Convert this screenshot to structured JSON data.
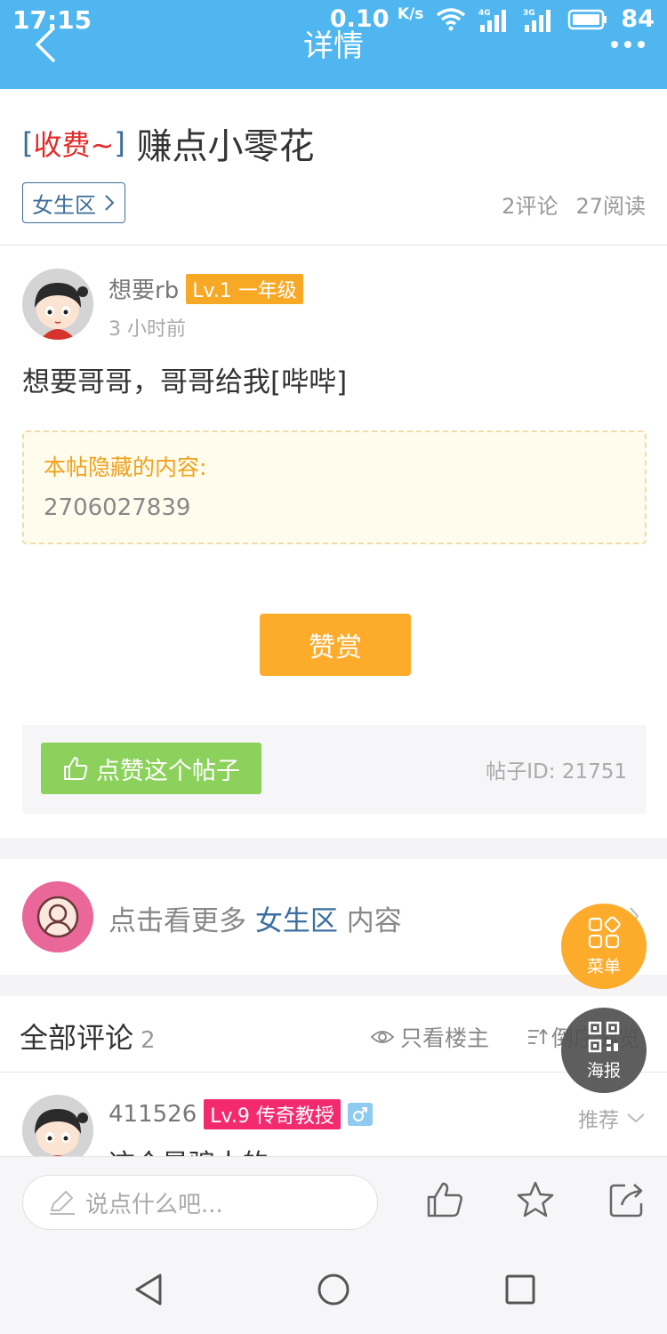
{
  "status_bar": {
    "time": "17:15",
    "network_speed": "0.10",
    "network_unit": "K/s",
    "network_4g": "4G",
    "network_3g": "3G",
    "battery": "84"
  },
  "header": {
    "title": "详情"
  },
  "post": {
    "tag_open": "[",
    "tag": "收费~",
    "tag_close": "]",
    "title": "赚点小零花",
    "section": "女生区",
    "comments_count": "2评论",
    "views_count": "27阅读",
    "author": {
      "name": "想要rb",
      "level": "Lv.1 一年级",
      "time": "3 小时前"
    },
    "content": "想要哥哥，哥哥给我[哔哔]",
    "hidden_label": "本帖隐藏的内容:",
    "hidden_value": "2706027839",
    "reward_label": "赞赏",
    "like_label": "点赞这个帖子",
    "post_id": "帖子ID: 21751"
  },
  "more_section": {
    "prefix": "点击看更多",
    "section": "女生区",
    "suffix": "内容"
  },
  "comments": {
    "title": "全部评论",
    "count": "2",
    "only_op_label": "只看楼主",
    "sort_label": "倒序浏览",
    "items": [
      {
        "author": "411526",
        "level": "Lv.9 传奇教授",
        "recommend_label": "推荐",
        "text": "这个是骗人的"
      }
    ]
  },
  "floating": {
    "menu_label": "菜单",
    "poster_label": "海报"
  },
  "bottom_bar": {
    "input_placeholder": "说点什么吧..."
  },
  "colors": {
    "header_bg": "#4fb6f0",
    "accent_orange": "#fdab2b",
    "like_green": "#8cd15c",
    "link_blue": "#3b6fa0",
    "tag_red": "#e22b2b"
  }
}
